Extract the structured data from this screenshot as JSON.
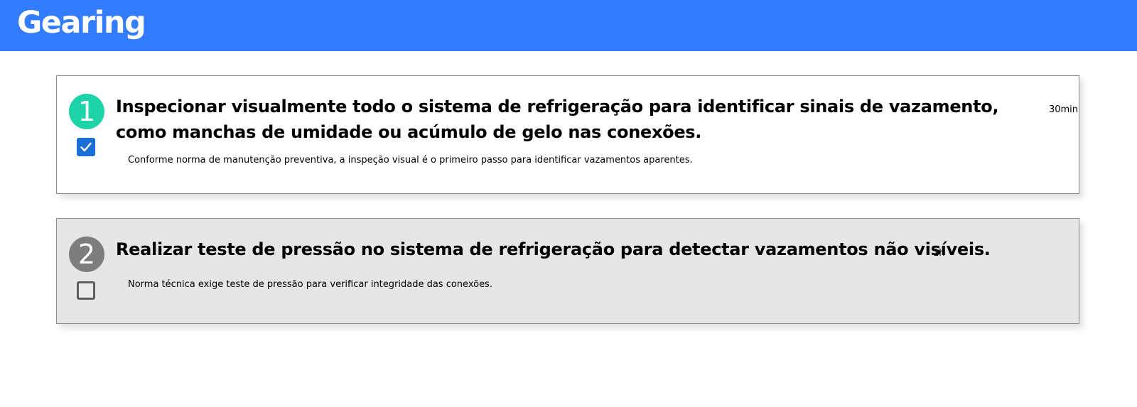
{
  "header": {
    "brand": "Gearing",
    "background_color": "#347cff"
  },
  "steps": [
    {
      "number": "1",
      "title": "Inspecionar visualmente todo o sistema de refrigeração para identificar sinais de vazamento, como manchas de umidade ou acúmulo de gelo nas conexões.",
      "duration": "30min",
      "note": "Conforme norma de manutenção preventiva, a inspeção visual é o primeiro passo para identificar vazamentos aparentes.",
      "checked": true,
      "badge_color": "#1dd4a8",
      "card_color": "#ffffff"
    },
    {
      "number": "2",
      "title": "Realizar teste de pressão no sistema de refrigeração para detectar vazamentos não visíveis.",
      "duration": "1h",
      "note": "Norma técnica exige teste de pressão para verificar integridade das conexões.",
      "checked": false,
      "badge_color": "#7d7d7d",
      "card_color": "#e6e6e6"
    }
  ]
}
